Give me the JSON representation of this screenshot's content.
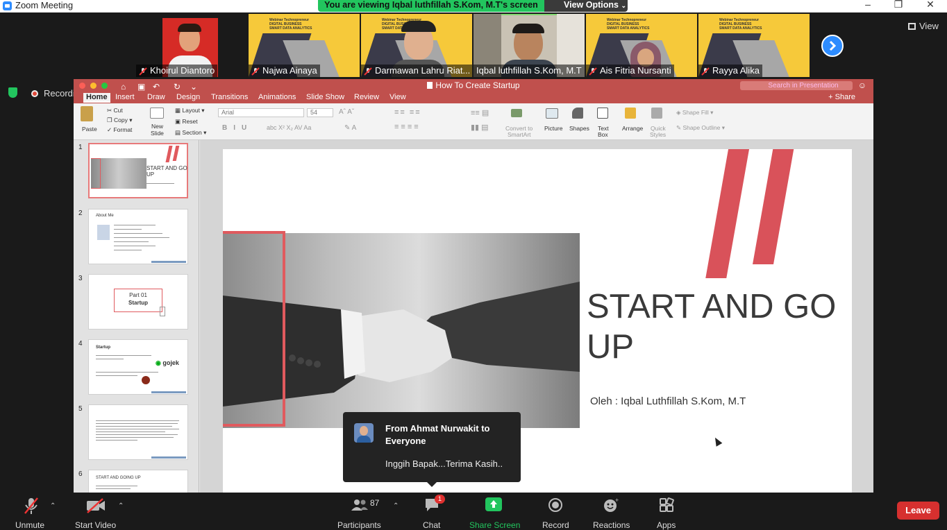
{
  "window": {
    "title": "Zoom Meeting"
  },
  "banner": {
    "viewing_text": "You are viewing Iqbal luthfillah S.Kom, M.T's screen",
    "view_options_label": "View Options"
  },
  "top_right": {
    "view_label": "View"
  },
  "participants_strip": [
    {
      "name": "Khoirul Diantoro"
    },
    {
      "name": "Najwa Ainaya"
    },
    {
      "name": "Darmawan Lahru Riat..."
    },
    {
      "name": "Iqbal luthfillah S.Kom, M.T"
    },
    {
      "name": "Ais Fitria Nursanti"
    },
    {
      "name": "Rayya Alika"
    }
  ],
  "recording": {
    "label": "Recording"
  },
  "powerpoint": {
    "doc_title": "How To Create Startup",
    "search_placeholder": "Search in Presentation",
    "share_label": "Share",
    "tabs": [
      "Home",
      "Insert",
      "Draw",
      "Design",
      "Transitions",
      "Animations",
      "Slide Show",
      "Review",
      "View"
    ],
    "ribbon": {
      "paste": "Paste",
      "cut": "Cut",
      "copy": "Copy",
      "format": "Format",
      "new_slide_1": "New",
      "new_slide_2": "Slide",
      "layout": "Layout",
      "reset": "Reset",
      "section": "Section",
      "font_name": "Arial",
      "font_size": "54",
      "convert_1": "Convert to",
      "convert_2": "SmartArt",
      "picture": "Picture",
      "shapes": "Shapes",
      "textbox_1": "Text",
      "textbox_2": "Box",
      "arrange": "Arrange",
      "quick_styles_1": "Quick",
      "quick_styles_2": "Styles",
      "shape_fill": "Shape Fill",
      "shape_outline": "Shape Outline"
    },
    "thumbnails": [
      {
        "num": "1",
        "title": "START AND GO UP"
      },
      {
        "num": "2",
        "title": "About Me"
      },
      {
        "num": "3",
        "title_1": "Part 01",
        "title_2": "Startup"
      },
      {
        "num": "4",
        "title": "Startup",
        "brand": "gojek"
      },
      {
        "num": "5"
      },
      {
        "num": "6",
        "title": "START AND GOING UP"
      }
    ],
    "slide": {
      "title": "START AND GO UP",
      "author": "Oleh : Iqbal Luthfillah S.Kom, M.T"
    }
  },
  "chat_popup": {
    "from": "From Ahmat Nurwakit to Everyone",
    "message": "Inggih Bapak...Terima Kasih.."
  },
  "toolbar": {
    "unmute": "Unmute",
    "start_video": "Start Video",
    "participants_count": "87",
    "participants": "Participants",
    "chat": "Chat",
    "chat_badge": "1",
    "share_screen": "Share Screen",
    "record": "Record",
    "reactions": "Reactions",
    "apps": "Apps",
    "leave": "Leave"
  },
  "colors": {
    "accent_red": "#e05a5e",
    "share_green": "#22c55e",
    "leave_red": "#d6302f",
    "zoom_blue": "#2d8cff",
    "ppt_red": "#c0504d"
  }
}
